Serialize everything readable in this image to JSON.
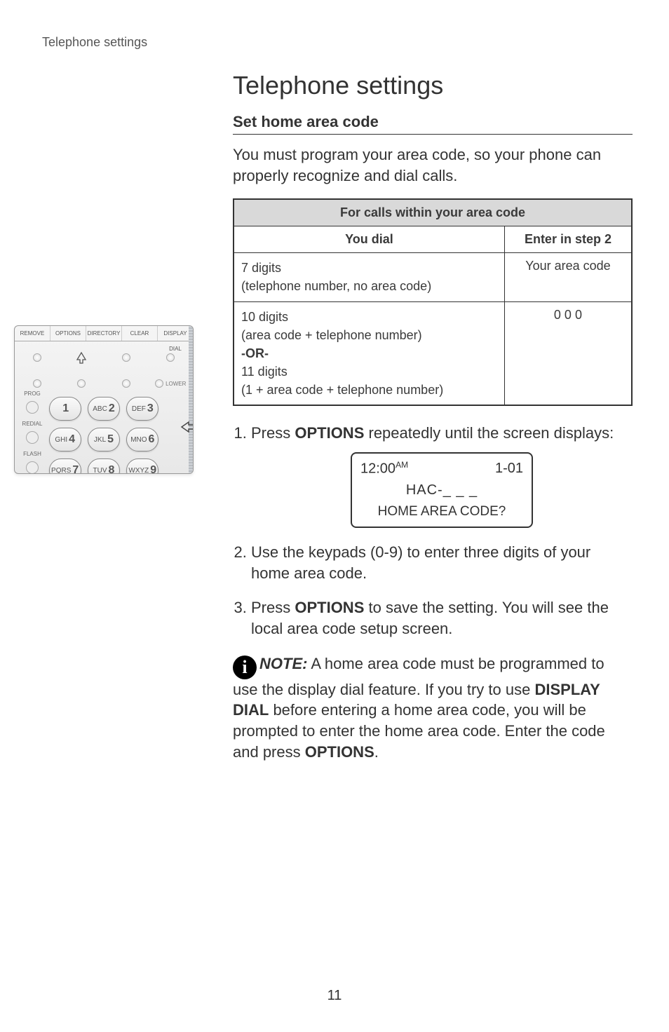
{
  "header": {
    "breadcrumb": "Telephone settings"
  },
  "title": "Telephone settings",
  "subtitle": "Set home area code",
  "intro": "You must program your area code, so your phone can properly recognize and dial calls.",
  "table": {
    "caption": "For calls within your area code",
    "col1": "You dial",
    "col2": "Enter in step 2",
    "rows": [
      {
        "dial_lines": [
          "7 digits",
          "(telephone number, no area code)"
        ],
        "enter": "Your area code"
      },
      {
        "dial_lines": [
          "10 digits",
          "(area code + telephone number)",
          "-OR-",
          "11 digits",
          "(1 + area code + telephone number)"
        ],
        "enter": "0 0 0"
      }
    ]
  },
  "steps": {
    "s1_pre": "Press ",
    "s1_kw": "OPTIONS",
    "s1_post": " repeatedly until the screen displays:",
    "s2": "Use the keypads (0-9) to enter three digits of your home area code.",
    "s3_pre": "Press ",
    "s3_kw": "OPTIONS",
    "s3_post": " to save the setting. You will see the local area code setup screen."
  },
  "lcd": {
    "time": "12:00",
    "ampm": "AM",
    "date": "1-01",
    "line2": "HAC-_ _ _",
    "line3": "HOME AREA CODE?"
  },
  "note": {
    "label": "NOTE:",
    "text_a": " A home area code must be programmed to use the display dial feature. If you try to use ",
    "kw": "DISPLAY DIAL",
    "text_b": " before entering a home area code, you will be prompted to enter the home area code. Enter the code and press ",
    "kw2": "OPTIONS",
    "text_c": "."
  },
  "keypad": {
    "tabs": [
      "REMOVE",
      "OPTIONS",
      "DIRECTORY",
      "CLEAR",
      "DISPLAY DIAL"
    ],
    "lower_label": "LOWER",
    "side": {
      "prog": "PROG",
      "redial": "REDIAL",
      "flash": "FLASH"
    },
    "keys": {
      "k1": {
        "letters": "",
        "num": "1"
      },
      "k2": {
        "letters": "ABC",
        "num": "2"
      },
      "k3": {
        "letters": "DEF",
        "num": "3"
      },
      "k4": {
        "letters": "GHI",
        "num": "4"
      },
      "k5": {
        "letters": "JKL",
        "num": "5"
      },
      "k6": {
        "letters": "MNO",
        "num": "6"
      },
      "k7": {
        "letters": "PQRS",
        "num": "7"
      },
      "k8": {
        "letters": "TUV",
        "num": "8"
      },
      "k9": {
        "letters": "WXYZ",
        "num": "9"
      }
    }
  },
  "page_number": "11"
}
